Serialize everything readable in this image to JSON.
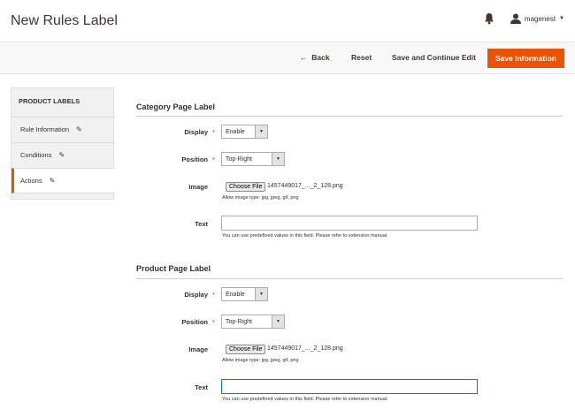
{
  "header": {
    "title": "New Rules Label",
    "username": "magenest"
  },
  "actions": {
    "back": "Back",
    "reset": "Reset",
    "save_continue": "Save and Continue Edit",
    "save_info": "Save Information"
  },
  "sidebar": {
    "title": "PRODUCT LABELS",
    "items": [
      {
        "label": "Rule Information"
      },
      {
        "label": "Conditions"
      },
      {
        "label": "Actions",
        "active": true
      }
    ]
  },
  "sections": [
    {
      "title": "Category Page Label",
      "display_label": "Display",
      "display_value": "Enable",
      "position_label": "Position",
      "position_value": "Top-Right",
      "image_label": "Image",
      "choose_file": "Choose File",
      "file_name": "1457449017_..._2_128.png",
      "image_note": "Allow image type: jpg, jpeg, gif, png",
      "text_label": "Text",
      "text_value": "",
      "text_note": "You can use predefined values in this field. Please refer to extension manual."
    },
    {
      "title": "Product Page Label",
      "display_label": "Display",
      "display_value": "Enable",
      "position_label": "Position",
      "position_value": "Top-Right",
      "image_label": "Image",
      "choose_file": "Choose File",
      "file_name": "1457449017_..._2_128.png",
      "image_note": "Allow image type: jpg, jpeg, gif, png",
      "text_label": "Text",
      "text_value": "",
      "text_note": "You can use predefined values in this field. Please refer to extension manual."
    }
  ],
  "colors": {
    "accent": "#eb5202",
    "required": "#e22626",
    "focus": "#007bdb"
  }
}
